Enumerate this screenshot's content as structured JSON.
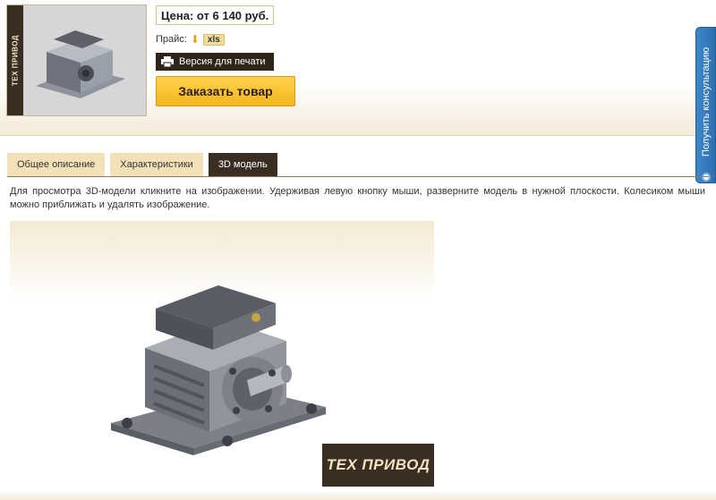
{
  "product": {
    "thumb_logo": "ТЕХ ПРИВОД",
    "price": "Цена: от 6 140 руб.",
    "pricelist_label": "Прайс:",
    "pricelist_icon": "download-arrow-icon",
    "pricelist_format": "xls",
    "print_label": "Версия для печати",
    "order_label": "Заказать товар"
  },
  "consult": {
    "label": "Получить консультацию"
  },
  "tabs": [
    {
      "label": "Общее описание",
      "active": false
    },
    {
      "label": "Характеристики",
      "active": false
    },
    {
      "label": "3D модель",
      "active": true
    }
  ],
  "description": "Для просмотра 3D-модели кликните на изображении. Удерживая левую кнопку мыши, разверните модель в нужной плоскости. Колесиком мыши можно приближать и удалять изображение.",
  "model": {
    "logo": "ТЕХ ПРИВОД"
  },
  "colors": {
    "accent_dark": "#3a2e22",
    "order_button": "#f5b51c",
    "consult_tab": "#2f6fb0",
    "tab_inactive": "#f3e2b8"
  }
}
